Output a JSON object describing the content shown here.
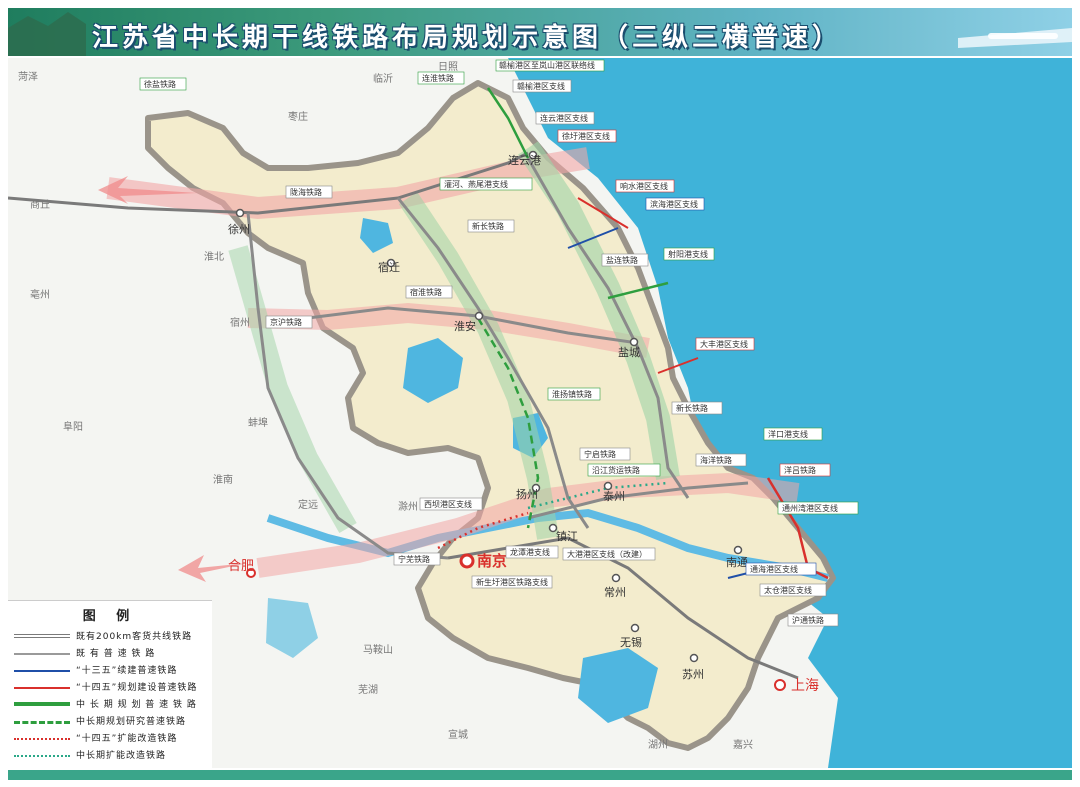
{
  "title": "江苏省中长期干线铁路布局规划示意图（三纵三横普速）",
  "colors": {
    "sea": "#3fb3d9",
    "province": "#f3eccd",
    "corridor_pink": "#f2a6a6",
    "corridor_green": "#9fd3a6",
    "existing_rail": "#8a8a8a",
    "red_rail": "#d9302c",
    "blue_rail": "#1f4fa8",
    "green_rail": "#2e9e3e"
  },
  "legend": {
    "title": "图 例",
    "items": [
      {
        "label": "既有200km客货共线铁路",
        "color": "#7a7a7a",
        "style": "double"
      },
      {
        "label": "既 有 普 速 铁 路",
        "color": "#9a9a9a",
        "style": "solid"
      },
      {
        "label": "“十三五”续建普速铁路",
        "color": "#1f4fa8",
        "style": "solid"
      },
      {
        "label": "“十四五”规划建设普速铁路",
        "color": "#d9302c",
        "style": "solid"
      },
      {
        "label": "中 长 期 规 划 普 速 铁 路",
        "color": "#2e9e3e",
        "style": "thick"
      },
      {
        "label": "中长期规划研究普速铁路",
        "color": "#2e9e3e",
        "style": "dashed"
      },
      {
        "label": "“十四五”扩能改造铁路",
        "color": "#d9302c",
        "style": "dotted"
      },
      {
        "label": "中长期扩能改造铁路",
        "color": "#2aa888",
        "style": "dotted"
      }
    ]
  },
  "cities": {
    "nanjing": "南京",
    "shanghai": "上海",
    "hefei": "合肥",
    "xuzhou": "徐州",
    "lianyungang": "连云港",
    "suqian": "宿迁",
    "huaian": "淮安",
    "yancheng": "盐城",
    "yangzhou": "扬州",
    "taizhou": "泰州",
    "zhenjiang": "镇江",
    "changzhou": "常州",
    "wuxi": "无锡",
    "suzhou": "苏州",
    "nantong": "南通",
    "shangqiu": "商丘",
    "bengbu": "蚌埠",
    "linyi": "临沂",
    "huaibei": "淮北",
    "suzhou_ah": "宿州",
    "chuzhou": "滁州",
    "maanshan": "马鞍山",
    "wuhu": "芜湖",
    "xuancheng": "宣城",
    "huzhou": "湖州",
    "jiaxing": "嘉兴",
    "heze": "菏泽",
    "zaozhuang": "枣庄",
    "rizhao": "日照",
    "bozhou": "亳州",
    "fuyang": "阜阳",
    "huainan": "淮南",
    "dingyuan": "定远"
  },
  "rail_labels": {
    "xuyan": "徐盐铁路",
    "longhai": "陇海铁路",
    "jinghu": "京沪铁路",
    "suhuai": "宿淮铁路",
    "xinchang": "新长铁路",
    "lianhuai": "连淮铁路",
    "yanxu": "连云港区支线",
    "ganyu": "赣榆港区支线",
    "xuwei": "徐圩港区支线",
    "guanhe": "灌河、燕尾港支线",
    "xiangshui": "响水港区支线",
    "binhai": "滨海港区支线",
    "yanli": "盐连铁路",
    "sheyang": "射阳港支线",
    "dafeng": "大丰港区支线",
    "huaiyangzhen": "淮扬镇铁路",
    "zhuangtong": "新长铁路",
    "xiyang": "宁启铁路",
    "yangzijiang": "沿江货运铁路",
    "ningwu": "宁芜铁路",
    "haian": "海洋铁路",
    "yangkou": "洋口港支线",
    "yanglu": "洋吕铁路",
    "tonghai": "通州湾港区支线",
    "xiba": "西坝港区支线",
    "longtan": "龙潭港支线",
    "dagang": "大港港区支线（改建）",
    "xinshengyu": "新生圩港区铁路支线",
    "nantong_port": "通海港区支线",
    "taicang": "太仓港区支线",
    "huning": "沪通铁路",
    "ganyu_top": "赣榆港区至岚山港区联络线"
  }
}
